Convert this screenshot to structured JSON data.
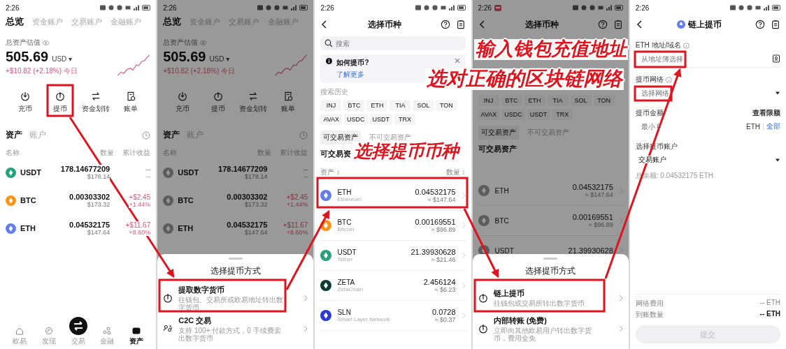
{
  "panels": [
    {
      "kind": "assets",
      "status_time": "2:26",
      "tabs": [
        {
          "label": "总览",
          "selected": true
        },
        {
          "label": "资金账户",
          "selected": false
        },
        {
          "label": "交易账户",
          "selected": false
        },
        {
          "label": "金融账户",
          "selected": false
        }
      ],
      "total_label": "总资产估值",
      "total": "505.69",
      "currency": "USD ▾",
      "change": "+$10.82 (+2.18%) 今日",
      "actions": [
        {
          "label": "充币",
          "kind": "deposit"
        },
        {
          "label": "提币",
          "kind": "withdraw"
        },
        {
          "label": "资金划转",
          "kind": "transfer"
        },
        {
          "label": "账单",
          "kind": "bill"
        }
      ],
      "subtabs": [
        {
          "label": "资产",
          "selected": true
        },
        {
          "label": "账户",
          "selected": false
        }
      ],
      "columns": [
        "名称",
        "数量",
        "累计收益"
      ],
      "rows": [
        {
          "symbol": "USDT",
          "color": "#26a17b",
          "amount": "178.14677209",
          "value": "$178.14",
          "pnl": "--",
          "pnl_pct": "--"
        },
        {
          "symbol": "BTC",
          "color": "#f7931a",
          "amount": "0.00303302",
          "value": "$173.32",
          "pnl": "+$2.45",
          "pnl_pct": "+1.44%"
        },
        {
          "symbol": "ETH",
          "color": "#627eea",
          "amount": "0.04532175",
          "value": "$147.64",
          "pnl": "+$11.67",
          "pnl_pct": "+8.60%"
        }
      ],
      "nav": [
        {
          "label": "欧易",
          "kind": "home",
          "selected": false
        },
        {
          "label": "发现",
          "kind": "discover",
          "selected": false
        },
        {
          "label": "交易",
          "kind": "trade",
          "selected": false
        },
        {
          "label": "金融",
          "kind": "finance",
          "selected": false
        },
        {
          "label": "资产",
          "kind": "assets",
          "selected": true
        }
      ]
    },
    {
      "kind": "assets",
      "dimmed": true,
      "status_time": "2:26",
      "tabs": [
        {
          "label": "总览",
          "selected": true
        },
        {
          "label": "资金账户",
          "selected": false
        },
        {
          "label": "交易账户",
          "selected": false
        },
        {
          "label": "金融账户",
          "selected": false
        }
      ],
      "total_label": "总资产估值",
      "total": "505.69",
      "currency": "USD ▾",
      "change": "+$10.82 (+2.18%) 今日",
      "actions": [
        {
          "label": "充币",
          "kind": "deposit"
        },
        {
          "label": "提币",
          "kind": "withdraw"
        },
        {
          "label": "资金划转",
          "kind": "transfer"
        },
        {
          "label": "账单",
          "kind": "bill"
        }
      ],
      "subtabs": [
        {
          "label": "资产",
          "selected": true
        },
        {
          "label": "账户",
          "selected": false
        }
      ],
      "columns": [
        "名称",
        "数量",
        "累计收益"
      ],
      "rows": [
        {
          "symbol": "USDT",
          "amount": "178.14677209",
          "value": "$178.14",
          "pnl": "--",
          "pnl_pct": "--"
        },
        {
          "symbol": "BTC",
          "amount": "0.00303302",
          "value": "$173.32",
          "pnl": "+$2.45",
          "pnl_pct": "+1.44%"
        },
        {
          "symbol": "ETH",
          "amount": "0.04532175",
          "value": "$147.64",
          "pnl": "+$11.67",
          "pnl_pct": "+8.60%"
        }
      ],
      "sheet": {
        "title": "选择提币方式",
        "options": [
          {
            "kind": "withdraw",
            "title": "提取数字货币",
            "desc": "往钱包、交易所或欧易地址转出数字货币"
          },
          {
            "kind": "c2c",
            "title": "C2C 交易",
            "desc": "支持 100+ 付款方式，0 手续费卖出数字货币"
          }
        ]
      }
    },
    {
      "kind": "coin_select",
      "status_time": "2:26",
      "title": "选择币种",
      "search_placeholder": "搜索",
      "notice": {
        "title": "如何提币?",
        "link": "了解更多"
      },
      "chips_label": "搜索历史",
      "chips": [
        "INJ",
        "BTC",
        "ETH",
        "TIA",
        "SOL",
        "TON",
        "AVAX",
        "USDC",
        "USDT",
        "TRX"
      ],
      "filter_tabs": [
        {
          "label": "可交易资产",
          "selected": true
        },
        {
          "label": "不可交易资产",
          "selected": false
        }
      ],
      "section": "可交易资",
      "sort": [
        "资产 ↕",
        "数量 ↕"
      ],
      "coins": [
        {
          "symbol": "ETH",
          "name": "Ethereum",
          "color": "#627eea",
          "amount": "0.04532175",
          "value": "≈ $147.64"
        },
        {
          "symbol": "BTC",
          "name": "Bitcoin",
          "color": "#f7931a",
          "amount": "0.00169551",
          "value": "≈ $96.89"
        },
        {
          "symbol": "USDT",
          "name": "Tether",
          "color": "#26a17b",
          "amount": "21.39930628",
          "value": "≈ $21.46"
        },
        {
          "symbol": "ZETA",
          "name": "ZetaChain",
          "color": "#0b3d2e",
          "amount": "2.456124",
          "value": "≈ $6.23"
        },
        {
          "symbol": "SLN",
          "name": "Smart Layer Network",
          "color": "#2a3bd6",
          "amount": "0.0728",
          "value": "≈ $0.37"
        }
      ]
    },
    {
      "kind": "coin_select",
      "dimmed": true,
      "status_time": "2:26",
      "status_alert": true,
      "title": "选择币种",
      "chips": [
        "INJ",
        "BTC",
        "ETH",
        "TIA",
        "SOL",
        "TON",
        "AVAX",
        "USDC",
        "USDT",
        "TRX"
      ],
      "filter_tabs": [
        {
          "label": "可交易资产",
          "selected": true
        },
        {
          "label": "不可交易资产",
          "selected": false
        }
      ],
      "section": "可交易资产",
      "coins": [
        {
          "symbol": "ETH",
          "amount": "0.04532175",
          "value": "≈ $147.64"
        },
        {
          "symbol": "BTC",
          "amount": "0.00169551",
          "value": "≈ $96.89"
        },
        {
          "symbol": "USDT",
          "amount": "21.39930628"
        }
      ],
      "sheet": {
        "title": "选择提币方式",
        "options": [
          {
            "kind": "withdraw",
            "title": "链上提币",
            "desc": "往钱包或交易所转出数字货币"
          },
          {
            "kind": "withdraw",
            "title": "内部转账 (免费)",
            "desc": "立即向其他欧易用户转出数字货币，费用全免"
          }
        ]
      }
    },
    {
      "kind": "withdraw_form",
      "status_time": "2:26",
      "title": "链上提币",
      "address_label": "ETH 地址/域名",
      "address_placeholder": "从地址簿选择",
      "network_label": "提币网络",
      "network_placeholder": "选择网络",
      "amount_label": "提币金额",
      "limit_link": "查看限额",
      "amount_placeholder": "最小 0",
      "amount_unit": "ETH",
      "max_button": "全部",
      "account_label": "选择提币账户",
      "account_value": "交易账户",
      "balance": "总余额: 0.04532175 ETH",
      "fee_label": "网络费用",
      "fee_value": "-- ETH",
      "receive_label": "到账数量",
      "receive_value": "-- ETH",
      "submit": {
        "label": "提交",
        "disabled": true
      }
    }
  ],
  "callouts": [
    {
      "text": "选择提币币种"
    },
    {
      "text": "输入钱包充值地址"
    },
    {
      "text": "选对正确的区块链网络"
    }
  ]
}
